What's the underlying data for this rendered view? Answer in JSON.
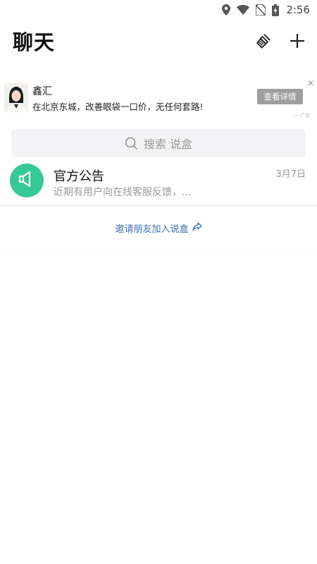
{
  "status_bar": {
    "time": "2:56",
    "icons": [
      "location-icon",
      "wifi-icon",
      "no-sim-icon",
      "battery-charging-icon"
    ]
  },
  "header": {
    "title": "聊天",
    "actions": [
      "broom-icon",
      "plus-icon"
    ]
  },
  "ad": {
    "name": "鑫汇",
    "description": "在北京东城，改善眼袋一口价，无任何套路!",
    "button_label": "查看详情",
    "close_label": "✕",
    "ad_tag": "广告"
  },
  "search": {
    "placeholder": "搜索 说盒"
  },
  "chats": [
    {
      "title": "官方公告",
      "preview": "近期有用户向在线客服反馈，...",
      "time": "3月7日",
      "avatar_color": "#36c997",
      "icon": "megaphone-icon"
    }
  ],
  "invite": {
    "label": "邀请朋友加入说盒",
    "icon": "share-icon",
    "color": "#3f6fb0"
  }
}
